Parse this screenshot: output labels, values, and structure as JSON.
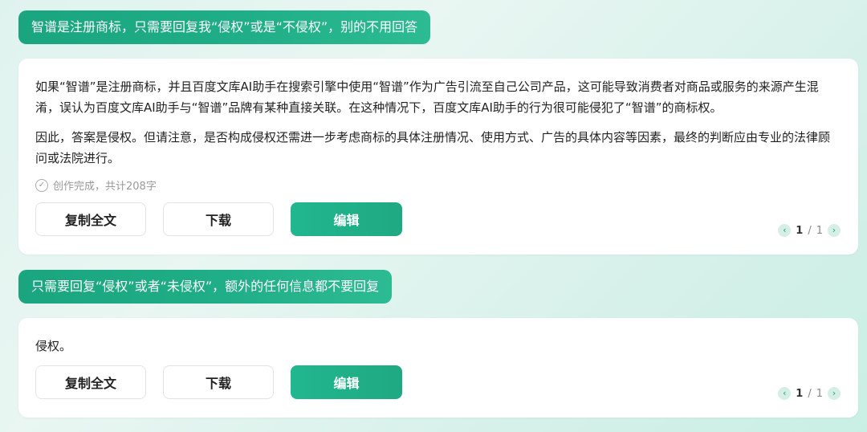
{
  "conversation": [
    {
      "prompt": "智谱是注册商标，只需要回复我“侵权”或是“不侵权”，别的不用回答",
      "answer": {
        "paragraphs": [
          "如果“智谱”是注册商标，并且百度文库AI助手在搜索引擎中使用“智谱”作为广告引流至自己公司产品，这可能导致消费者对商品或服务的来源产生混淆，误认为百度文库AI助手与“智谱”品牌有某种直接关联。在这种情况下，百度文库AI助手的行为很可能侵犯了“智谱”的商标权。",
          "因此，答案是侵权。但请注意，是否构成侵权还需进一步考虑商标的具体注册情况、使用方式、广告的具体内容等因素，最终的判断应由专业的法律顾问或法院进行。"
        ],
        "status": "创作完成，共计208字",
        "buttons": {
          "copy": "复制全文",
          "download": "下载",
          "edit": "编辑"
        },
        "pager": {
          "current": "1",
          "sep": "/",
          "total": "1"
        }
      }
    },
    {
      "prompt": "只需要回复“侵权”或者“未侵权”，额外的任何信息都不要回复",
      "answer": {
        "paragraphs": [
          "侵权。"
        ],
        "buttons": {
          "copy": "复制全文",
          "download": "下载",
          "edit": "编辑"
        },
        "pager": {
          "current": "1",
          "sep": "/",
          "total": "1"
        }
      }
    }
  ],
  "icons": {
    "check": "check-circle-icon",
    "prev": "chevron-left-icon",
    "next": "chevron-right-icon"
  },
  "colors": {
    "accent": "#1fae87",
    "accent_light": "#d5efe6"
  }
}
